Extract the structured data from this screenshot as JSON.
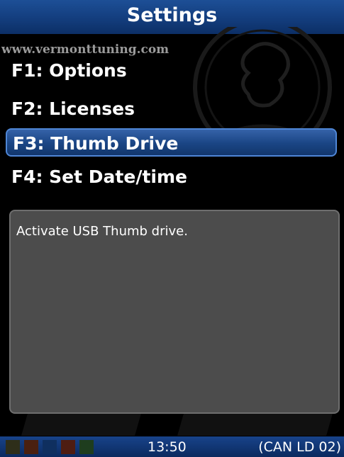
{
  "header": {
    "title": "Settings"
  },
  "watermark": {
    "url": "www.vermonttuning.com"
  },
  "menu": {
    "items": [
      {
        "label": "F1: Options"
      },
      {
        "label": "F2: Licenses"
      },
      {
        "label": "F3: Thumb Drive",
        "selected": true
      },
      {
        "label": "F4: Set Date/time"
      }
    ]
  },
  "description": {
    "text": "Activate USB Thumb drive."
  },
  "status": {
    "time": "13:50",
    "connection": "(CAN LD 02)",
    "indicator_colors": [
      "#2e2e1a",
      "#4a2010",
      "#0f2f5f",
      "#4e1d12",
      "#1e3d1e"
    ]
  },
  "colors": {
    "title_bar": "#143f80",
    "selection": "#1a4584",
    "panel": "#4c4c4c"
  }
}
